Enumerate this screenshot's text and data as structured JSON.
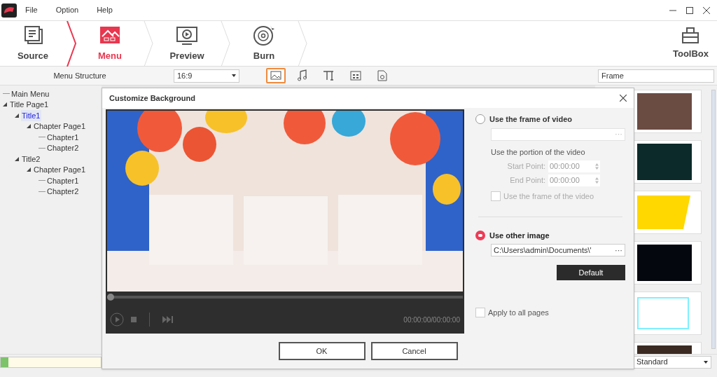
{
  "menu_bar": [
    "File",
    "Option",
    "Help"
  ],
  "steps": [
    {
      "label": "Source",
      "kind": "source",
      "selected": false
    },
    {
      "label": "Menu",
      "kind": "menu",
      "selected": true
    },
    {
      "label": "Preview",
      "kind": "preview",
      "selected": false
    },
    {
      "label": "Burn",
      "kind": "burn",
      "selected": false
    }
  ],
  "toolbox": "ToolBox",
  "menu_structure_label": "Menu Structure",
  "aspect_ratio": "16:9",
  "tools": [
    {
      "kind": "background",
      "selected": true
    },
    {
      "kind": "music",
      "selected": false
    },
    {
      "kind": "text",
      "selected": false
    },
    {
      "kind": "chapters",
      "selected": false
    },
    {
      "kind": "export",
      "selected": false
    }
  ],
  "tree": [
    {
      "label": "Main Menu",
      "selected": false
    },
    {
      "label": "Title Page1",
      "selected": false,
      "children": [
        {
          "label": "Title1",
          "selected": true,
          "children": [
            {
              "label": "Chapter Page1",
              "selected": false,
              "children": [
                {
                  "label": "Chapter1",
                  "selected": false
                },
                {
                  "label": "Chapter2",
                  "selected": false
                }
              ]
            }
          ]
        },
        {
          "label": "Title2",
          "selected": false,
          "children": [
            {
              "label": "Chapter Page1",
              "selected": false,
              "children": [
                {
                  "label": "Chapter1",
                  "selected": false
                },
                {
                  "label": "Chapter2",
                  "selected": false
                }
              ]
            }
          ]
        }
      ]
    }
  ],
  "frame_dropdown": "Frame",
  "frames": [
    {
      "kind": "fill",
      "color": "#6b4c42"
    },
    {
      "kind": "fill",
      "color": "#0c2a2a"
    },
    {
      "kind": "trapezoid",
      "color": "#ffd800"
    },
    {
      "kind": "fill",
      "color": "#05070f"
    },
    {
      "kind": "outline",
      "color": "#7ff0ff"
    },
    {
      "kind": "fill",
      "color": "#3a2a22"
    }
  ],
  "quality": "Standard",
  "disc_usage": {
    "level": 0.08
  },
  "dialog": {
    "title": "Customize Background",
    "player": {
      "level": 0.0,
      "time": "00:00:00/00:00:00"
    },
    "frame_option": {
      "label": "Use the frame of video",
      "selected": false,
      "browse": "···"
    },
    "portion_label": "Use the portion of the video",
    "points": [
      {
        "label": "Start Point:",
        "value": "00:00:00"
      },
      {
        "label": "End Point:",
        "value": "00:00:00"
      }
    ],
    "frame_checkbox": {
      "label": "Use the frame of the video",
      "checked": false
    },
    "image_option": {
      "label": "Use other image",
      "selected": true,
      "path": "C:\\Users\\admin\\Documents\\'",
      "browse": "···"
    },
    "default_button": "Default",
    "apply_all": {
      "label": "Apply to all pages",
      "checked": false
    },
    "buttons": [
      "OK",
      "Cancel"
    ]
  }
}
